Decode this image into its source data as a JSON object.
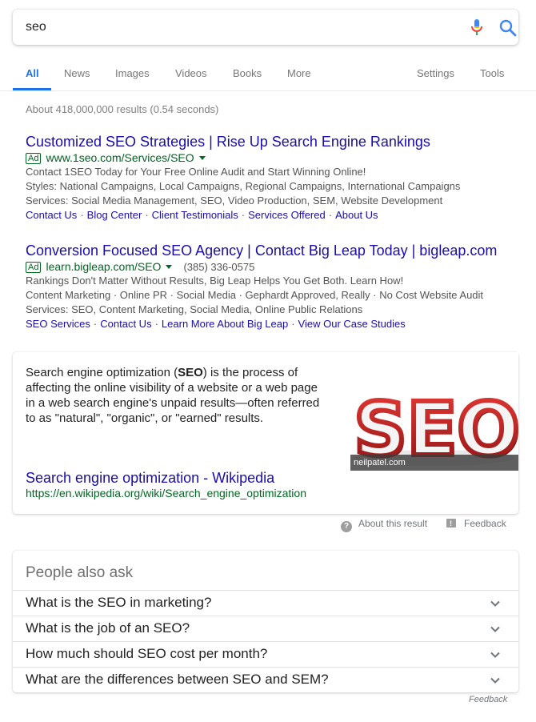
{
  "search": {
    "query": "seo"
  },
  "tabs": {
    "all": "All",
    "news": "News",
    "images": "Images",
    "videos": "Videos",
    "books": "Books",
    "more": "More",
    "settings": "Settings",
    "tools": "Tools"
  },
  "stats": "About 418,000,000 results (0.54 seconds)",
  "ads": [
    {
      "title": "Customized SEO Strategies | Rise Up Search Engine Rankings",
      "badge": "Ad",
      "url": "www.1seo.com/Services/SEO",
      "phone": "",
      "lines": [
        "Contact 1SEO Today for Your Free Online Audit and Start Winning Online!",
        "Styles: National Campaigns, Local Campaigns, Regional Campaigns, International Campaigns",
        "Services: Social Media Management, SEO, Video Production, SEM, Website Development"
      ],
      "sitelinks": [
        "Contact Us",
        "Blog Center",
        "Client Testimonials",
        "Services Offered",
        "About Us"
      ]
    },
    {
      "title": "Conversion Focused SEO Agency | Contact Big Leap Today | bigleap.com",
      "badge": "Ad",
      "url": "learn.bigleap.com/SEO",
      "phone": "(385) 336-0575",
      "lines": [
        "Rankings Don't Matter Without Results, Big Leap Helps You Get Both. Learn How!",
        "Content Marketing · Online PR · Social Media · Gephardt Approved, Really · No Cost Website Audit",
        "Services: SEO, Content Marketing, Social Media, Online Public Relations"
      ],
      "sitelinks": [
        "SEO Services",
        "Contact Us",
        "Learn More About Big Leap",
        "View Our Case Studies"
      ]
    }
  ],
  "knowledge": {
    "desc_pre": "Search engine optimization (",
    "desc_bold": "SEO",
    "desc_post": ") is the process of affecting the online visibility of a website or a web page in a web search engine's unpaid results—often referred to as \"natural\", \"organic\", or \"earned\" results.",
    "image_caption": "neilpatel.com",
    "image_text": "SEO",
    "title": "Search engine optimization - Wikipedia",
    "url": "https://en.wikipedia.org/wiki/Search_engine_optimization"
  },
  "about_result": "About this result",
  "feedback": "Feedback",
  "paa": {
    "heading": "People also ask",
    "questions": [
      "What is the SEO in marketing?",
      "What is the job of an SEO?",
      "How much should SEO cost per month?",
      "What are the differences between SEO and SEM?"
    ]
  },
  "footer_feedback": "Feedback",
  "colors": {
    "link": "#1a0dab",
    "url": "#006621",
    "accent": "#1a73e8",
    "seo_red": "#c62828"
  },
  "icons": [
    "mic-icon",
    "search-icon",
    "help-icon",
    "feedback-icon",
    "chevron-down-icon"
  ]
}
